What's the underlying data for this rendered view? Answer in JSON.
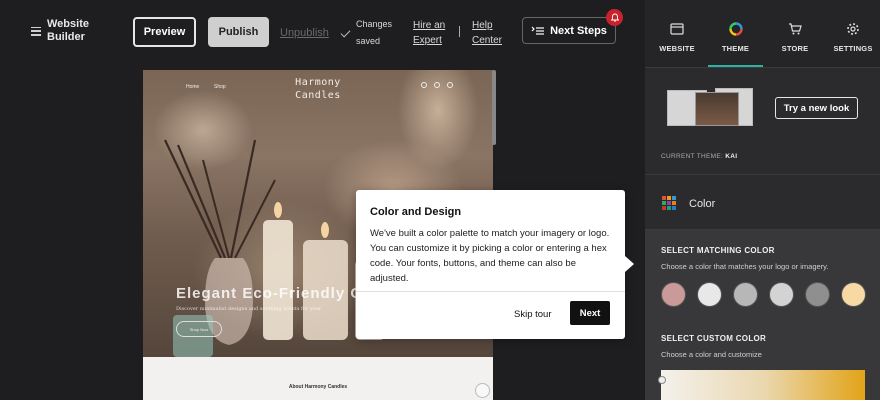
{
  "topbar": {
    "brand": "Website Builder",
    "preview_label": "Preview",
    "publish_label": "Publish",
    "unpublish_label": "Unpublish",
    "saved_text": "Changes saved",
    "hire_label": "Hire an Expert",
    "help_label": "Help Center",
    "next_steps_label": "Next Steps"
  },
  "site": {
    "nav_home": "Home",
    "nav_shop": "Shop",
    "title": "Harmony Candles",
    "hero_title": "Elegant Eco-Friendly C",
    "hero_subtitle": "Discover minimalist designs and soothing scents for your",
    "hero_button": "Shop Now",
    "about_title": "About Harmony Candles"
  },
  "tooltip": {
    "title": "Color and Design",
    "body": "We've built a color palette to match your imagery or logo. You can customize it by picking a color or entering a hex code. Your fonts, buttons, and theme can also be adjusted.",
    "skip_label": "Skip tour",
    "next_label": "Next"
  },
  "panel": {
    "tabs": [
      {
        "label": "WEBSITE",
        "icon": "browser-window-icon"
      },
      {
        "label": "THEME",
        "icon": "color-wheel-icon"
      },
      {
        "label": "STORE",
        "icon": "shopping-cart-icon"
      },
      {
        "label": "SETTINGS",
        "icon": "gear-icon"
      }
    ],
    "active_tab": "THEME",
    "try_new_look": "Try a new look",
    "current_theme_label": "CURRENT THEME:",
    "current_theme_value": "KAI",
    "color_section": "Color",
    "matching_title": "SELECT MATCHING COLOR",
    "matching_sub": "Choose a color that matches your logo or imagery.",
    "swatches": [
      "#c99a97",
      "#e8e8e8",
      "#b7b7b7",
      "#d3d3d3",
      "#8f8f8f",
      "#f7d9a4"
    ],
    "custom_title": "SELECT CUSTOM COLOR",
    "custom_sub": "Choose a color and customize"
  },
  "colors": {
    "accent": "#2bb2a0",
    "notification": "#c8232c"
  }
}
